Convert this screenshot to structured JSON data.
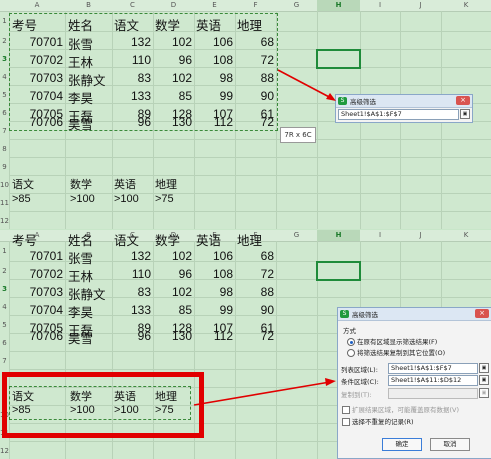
{
  "columns": [
    "A",
    "B",
    "C",
    "D",
    "E",
    "F",
    "G",
    "H",
    "I",
    "J",
    "K"
  ],
  "selected_column": "H",
  "selected_row": "3",
  "rows_top": [
    "1",
    "2",
    "3",
    "4",
    "5",
    "6",
    "7",
    "8",
    "9",
    "10",
    "11",
    "12"
  ],
  "rows_bottom": [
    "1",
    "2",
    "3",
    "4",
    "5",
    "6",
    "7",
    "8",
    "9",
    "10",
    "11",
    "12"
  ],
  "table": {
    "headers": [
      "考号",
      "姓名",
      "语文",
      "数学",
      "英语",
      "地理"
    ],
    "rows": [
      [
        "70701",
        "张雪",
        "132",
        "102",
        "106",
        "68"
      ],
      [
        "70702",
        "王林",
        "110",
        "96",
        "108",
        "72"
      ],
      [
        "70703",
        "张静文",
        "83",
        "102",
        "98",
        "88"
      ],
      [
        "70704",
        "李昊",
        "133",
        "85",
        "99",
        "90"
      ],
      [
        "70705",
        "王磊",
        "89",
        "128",
        "107",
        "61"
      ],
      [
        "70706",
        "吴雪",
        "96",
        "130",
        "112",
        "72"
      ]
    ]
  },
  "criteria": {
    "headers": [
      "语文",
      "数学",
      "英语",
      "地理"
    ],
    "values": [
      ">85",
      ">100",
      ">100",
      ">75"
    ]
  },
  "tooltip": "7R x 6C",
  "mini_dialog": {
    "title": "高级筛选",
    "range_value": "Sheet1!$A$1:$F$7",
    "close": "×",
    "logo": "S"
  },
  "dialog": {
    "title": "高级筛选",
    "logo": "S",
    "close": "×",
    "section_label": "方式",
    "radio_inplace": "在原有区域显示筛选结果(F)",
    "radio_copy": "将筛选结果复制到其它位置(O)",
    "list_label": "列表区域(L):",
    "list_value": "Sheet1!$A$1:$F$7",
    "criteria_label": "条件区域(C):",
    "criteria_value": "Sheet1!$A$11:$D$12",
    "copyto_label": "复制到(T):",
    "expand_label": "扩展结果区域，可能覆盖原有数据(V)",
    "unique_label": "选择不重复的记录(R)",
    "ok": "确定",
    "cancel": "取消"
  },
  "colors": {
    "sheet_bg": "#cfe8cf",
    "accent": "#1f8b3a",
    "highlight": "#e10000"
  }
}
